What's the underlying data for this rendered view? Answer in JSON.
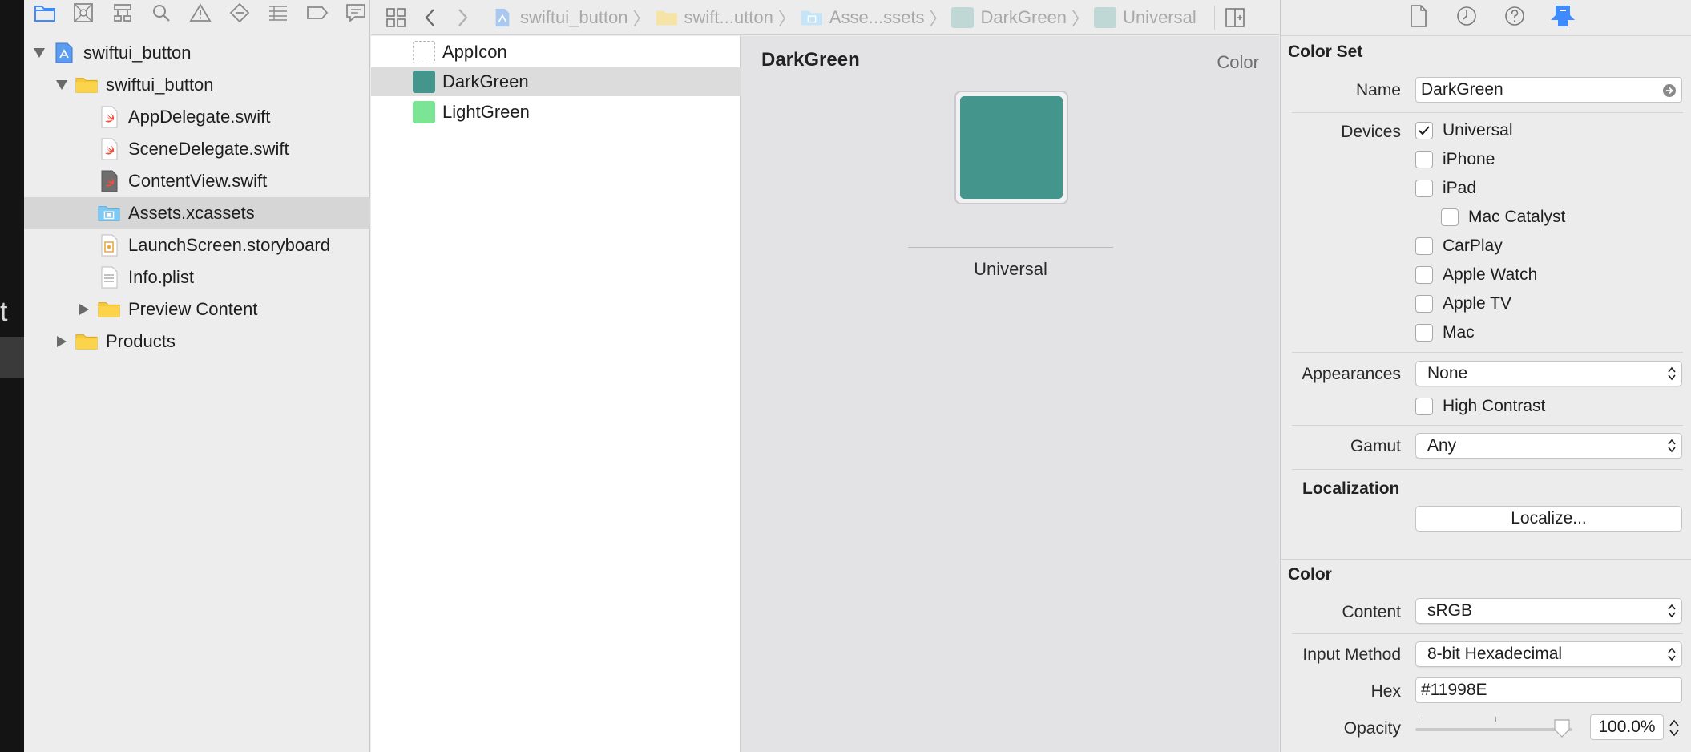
{
  "navigator": {
    "tree": [
      {
        "label": "swiftui_button",
        "icon": "project-icon",
        "disclosure": "expanded"
      },
      {
        "label": "swiftui_button",
        "icon": "folder-icon",
        "disclosure": "expanded"
      },
      {
        "label": "AppDelegate.swift",
        "icon": "swift-file-icon"
      },
      {
        "label": "SceneDelegate.swift",
        "icon": "swift-file-icon"
      },
      {
        "label": "ContentView.swift",
        "icon": "swift-file-icon"
      },
      {
        "label": "Assets.xcassets",
        "icon": "asset-catalog-icon",
        "selected": true
      },
      {
        "label": "LaunchScreen.storyboard",
        "icon": "storyboard-icon"
      },
      {
        "label": "Info.plist",
        "icon": "plist-icon"
      },
      {
        "label": "Preview Content",
        "icon": "folder-icon",
        "disclosure": "collapsed"
      },
      {
        "label": "Products",
        "icon": "folder-icon",
        "disclosure": "collapsed"
      }
    ]
  },
  "jumpbar": {
    "crumbs": [
      "swiftui_button",
      "swift...utton",
      "Asse...ssets",
      "DarkGreen",
      "Universal"
    ]
  },
  "assets": [
    {
      "label": "AppIcon",
      "kind": "appicon"
    },
    {
      "label": "DarkGreen",
      "kind": "color",
      "color": "#11998E",
      "selected": true
    },
    {
      "label": "LightGreen",
      "kind": "color",
      "color": "#7BE495"
    }
  ],
  "detail": {
    "title": "DarkGreen",
    "kind": "Color",
    "swatch_color": "#11998E",
    "swatch_label": "Universal"
  },
  "inspector": {
    "color_set_heading": "Color Set",
    "name_label": "Name",
    "name_value": "DarkGreen",
    "devices_label": "Devices",
    "devices": [
      {
        "label": "Universal",
        "checked": true
      },
      {
        "label": "iPhone",
        "checked": false
      },
      {
        "label": "iPad",
        "checked": false
      },
      {
        "label": "Mac Catalyst",
        "checked": false,
        "indent": true
      },
      {
        "label": "CarPlay",
        "checked": false
      },
      {
        "label": "Apple Watch",
        "checked": false
      },
      {
        "label": "Apple TV",
        "checked": false
      },
      {
        "label": "Mac",
        "checked": false
      }
    ],
    "appearances_label": "Appearances",
    "appearances_value": "None",
    "high_contrast_label": "High Contrast",
    "gamut_label": "Gamut",
    "gamut_value": "Any",
    "localization_heading": "Localization",
    "localize_button": "Localize...",
    "color_heading": "Color",
    "content_label": "Content",
    "content_value": "sRGB",
    "input_method_label": "Input Method",
    "input_method_value": "8-bit Hexadecimal",
    "hex_label": "Hex",
    "hex_value": "#11998E",
    "opacity_label": "Opacity",
    "opacity_value": "100.0%",
    "opacity_fraction": 1.0
  },
  "colors": {
    "accent": "#3d8bff",
    "dark_green": "#11998E",
    "light_green": "#7BE495"
  }
}
